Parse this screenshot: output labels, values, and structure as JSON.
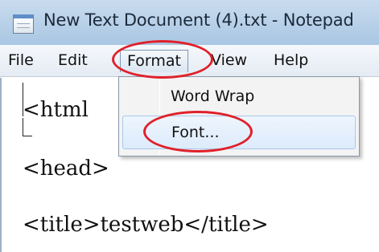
{
  "window": {
    "title": "New Text Document (4).txt - Notepad",
    "icon": "notepad-icon"
  },
  "menubar": {
    "items": [
      "File",
      "Edit",
      "Format",
      "View",
      "Help"
    ],
    "open_menu": "Format"
  },
  "format_menu": {
    "items": [
      "Word Wrap",
      "Font..."
    ],
    "highlighted": "Font..."
  },
  "editor": {
    "lines": [
      "<html",
      "<head>",
      "<title>testweb</title>"
    ]
  },
  "annotations": {
    "color": "#e0202a",
    "circled": [
      "Format",
      "Font..."
    ]
  }
}
